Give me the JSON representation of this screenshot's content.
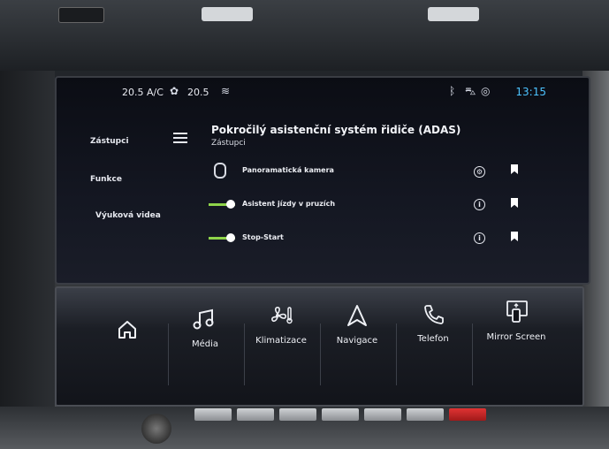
{
  "status_bar": {
    "temp_left": "20.5 A/C",
    "temp_right": "20.5",
    "clock": "13:15",
    "icons": [
      "fan-icon",
      "seat-heat-icon",
      "bluetooth-icon",
      "car-icon",
      "location-icon"
    ]
  },
  "side_menu": {
    "items": [
      {
        "label": "Zástupci"
      },
      {
        "label": "Funkce"
      },
      {
        "label": "Výuková videa"
      }
    ]
  },
  "page": {
    "title": "Pokročilý asistenční systém řidiče (ADAS)",
    "subtitle": "Zástupci"
  },
  "features": [
    {
      "label": "Panoramatická kamera",
      "control": "camera-icon"
    },
    {
      "label": "Asistent jízdy v pruzích",
      "control": "toggle",
      "enabled": true
    },
    {
      "label": "Stop-Start",
      "control": "toggle",
      "enabled": true
    }
  ],
  "touchbar": {
    "buttons": [
      {
        "label": "",
        "icon": "home-icon"
      },
      {
        "label": "Média",
        "icon": "music-icon"
      },
      {
        "label": "Klimatizace",
        "icon": "climate-icon"
      },
      {
        "label": "Navigace",
        "icon": "navigation-icon"
      },
      {
        "label": "Telefon",
        "icon": "phone-icon"
      },
      {
        "label": "Mirror Screen",
        "icon": "mirror-screen-icon"
      }
    ]
  },
  "colors": {
    "accent": "#4cc3ff",
    "toggle_on": "#8fd44a"
  }
}
